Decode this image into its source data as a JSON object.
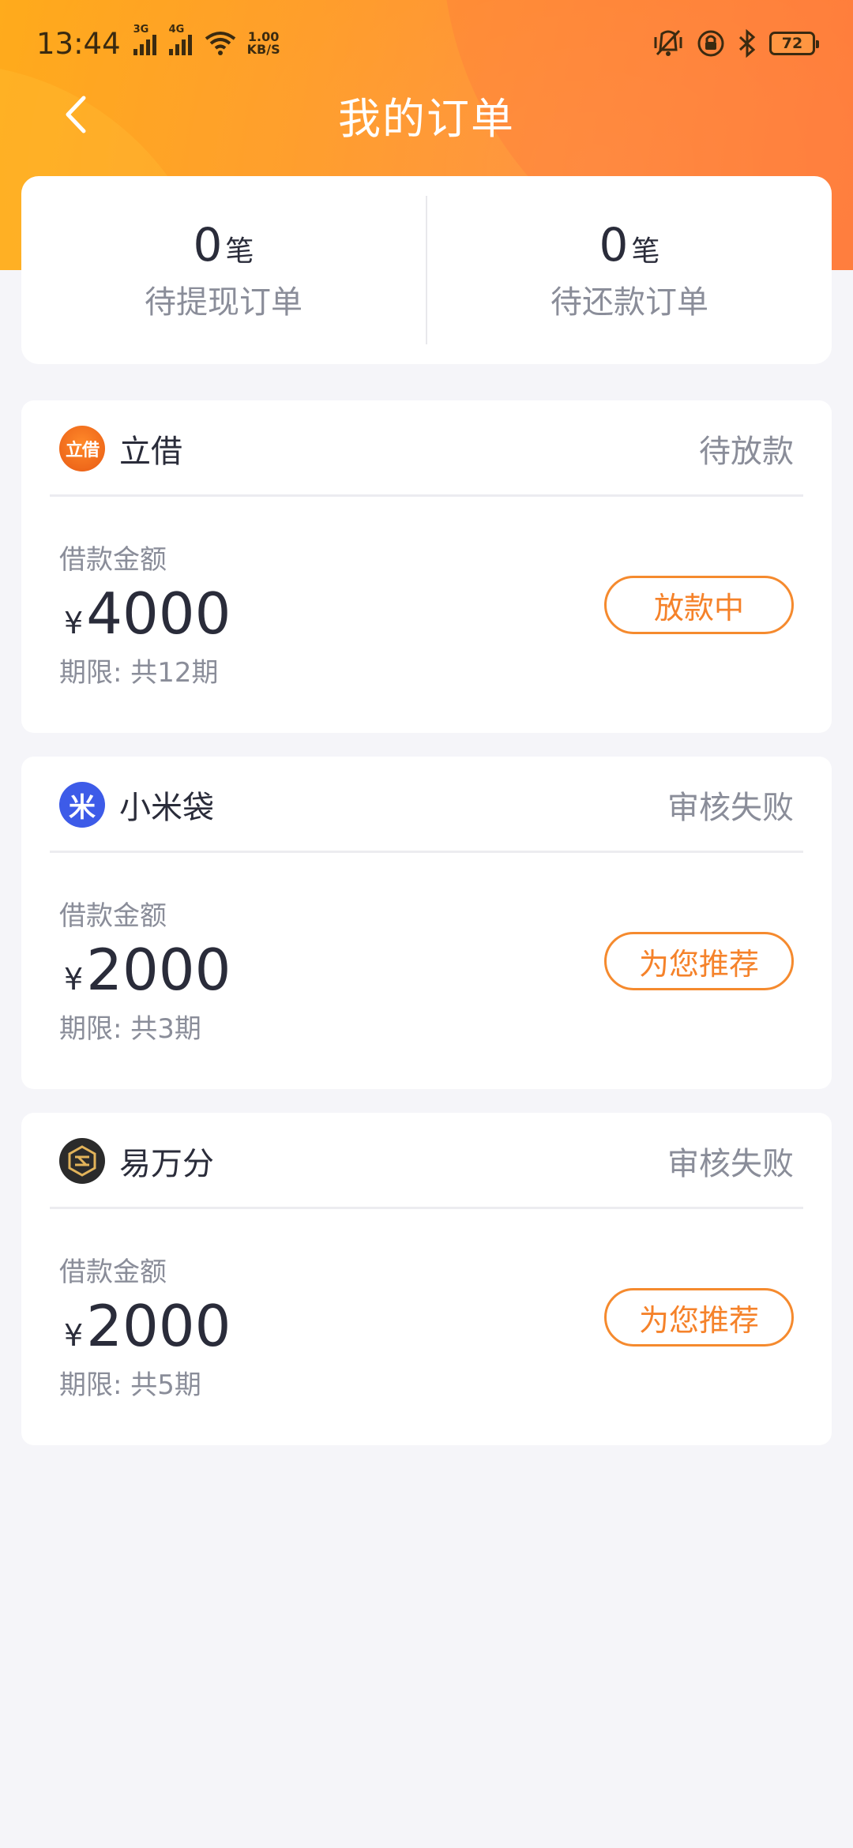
{
  "status_bar": {
    "time": "13:44",
    "signal1": "3G",
    "signal2": "4G",
    "net_speed_value": "1.00",
    "net_speed_unit": "KB/S",
    "battery": "72"
  },
  "header": {
    "title": "我的订单"
  },
  "summary": {
    "pending_withdraw": {
      "count": "0",
      "unit": "笔",
      "label": "待提现订单"
    },
    "pending_repay": {
      "count": "0",
      "unit": "笔",
      "label": "待还款订单"
    }
  },
  "orders": [
    {
      "brand": "立借",
      "logo_text": "立借",
      "logo_color": "#f06a1e",
      "status": "待放款",
      "amount_label": "借款金额",
      "currency": "¥",
      "amount": "4000",
      "term": "期限: 共12期",
      "action": "放款中"
    },
    {
      "brand": "小米袋",
      "logo_text": "米",
      "logo_color": "#3d5be8",
      "status": "审核失败",
      "amount_label": "借款金额",
      "currency": "¥",
      "amount": "2000",
      "term": "期限: 共3期",
      "action": "为您推荐"
    },
    {
      "brand": "易万分",
      "logo_text": "",
      "logo_color": "#2b2b2b",
      "status": "审核失败",
      "amount_label": "借款金额",
      "currency": "¥",
      "amount": "2000",
      "term": "期限: 共5期",
      "action": "为您推荐"
    }
  ],
  "colors": {
    "accent": "#f5822a",
    "header_gradient_start": "#ffab1c",
    "header_gradient_end": "#ff7a34",
    "muted_text": "#8a8d99"
  }
}
